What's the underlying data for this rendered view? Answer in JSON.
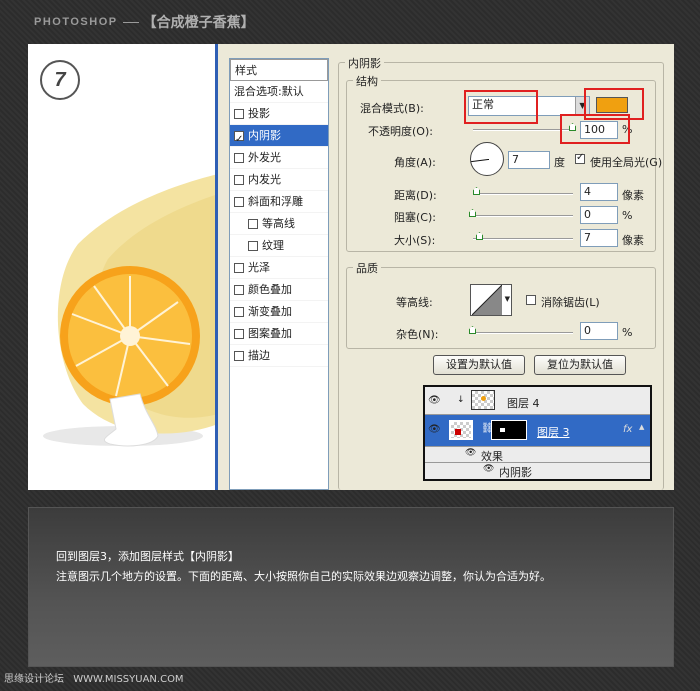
{
  "header": {
    "brand": "PHOTOSHOP",
    "title": "【合成橙子香蕉】"
  },
  "step_number": "7",
  "styles_panel": {
    "header": "样式",
    "items": [
      {
        "label": "混合选项:默认",
        "checkbox": false,
        "checked": false,
        "active": false,
        "indent": false
      },
      {
        "label": "投影",
        "checkbox": true,
        "checked": false,
        "active": false,
        "indent": false
      },
      {
        "label": "内阴影",
        "checkbox": true,
        "checked": true,
        "active": true,
        "indent": false
      },
      {
        "label": "外发光",
        "checkbox": true,
        "checked": false,
        "active": false,
        "indent": false
      },
      {
        "label": "内发光",
        "checkbox": true,
        "checked": false,
        "active": false,
        "indent": false
      },
      {
        "label": "斜面和浮雕",
        "checkbox": true,
        "checked": false,
        "active": false,
        "indent": false
      },
      {
        "label": "等高线",
        "checkbox": true,
        "checked": false,
        "active": false,
        "indent": true
      },
      {
        "label": "纹理",
        "checkbox": true,
        "checked": false,
        "active": false,
        "indent": true
      },
      {
        "label": "光泽",
        "checkbox": true,
        "checked": false,
        "active": false,
        "indent": false
      },
      {
        "label": "颜色叠加",
        "checkbox": true,
        "checked": false,
        "active": false,
        "indent": false
      },
      {
        "label": "渐变叠加",
        "checkbox": true,
        "checked": false,
        "active": false,
        "indent": false
      },
      {
        "label": "图案叠加",
        "checkbox": true,
        "checked": false,
        "active": false,
        "indent": false
      },
      {
        "label": "描边",
        "checkbox": true,
        "checked": false,
        "active": false,
        "indent": false
      }
    ]
  },
  "inner_shadow": {
    "group_title": "内阴影",
    "structure": {
      "title": "结构",
      "blend_mode_label": "混合模式(B):",
      "blend_mode_value": "正常",
      "shadow_color": "#f0a010",
      "opacity_label": "不透明度(O):",
      "opacity_value": "100",
      "opacity_percent": 100,
      "angle_label": "角度(A):",
      "angle_value": "7",
      "angle_unit": "度",
      "global_light_label": "使用全局光(G)",
      "global_light_checked": true,
      "distance_label": "距离(D):",
      "distance_value": "4",
      "distance_percent": 4,
      "choke_label": "阻塞(C):",
      "choke_value": "0",
      "choke_percent": 0,
      "size_label": "大小(S):",
      "size_value": "7",
      "size_percent": 7,
      "unit_px": "像素",
      "unit_percent": "%"
    },
    "quality": {
      "title": "品质",
      "contour_label": "等高线:",
      "anti_alias_label": "消除锯齿(L)",
      "noise_label": "杂色(N):",
      "noise_value": "0",
      "noise_percent": 0
    },
    "buttons": {
      "make_default": "设置为默认值",
      "reset_default": "复位为默认值"
    }
  },
  "layers_panel": {
    "layer4_name": "图层 4",
    "layer3_name": "图层 3",
    "effects_label": "效果",
    "effect_item": "内阴影",
    "fx_label": "fx"
  },
  "caption": {
    "line1": "回到图层3，添加图层样式【内阴影】",
    "line2": "注意图示几个地方的设置。下面的距离、大小按照你自己的实际效果边观察边调整，你认为合适为好。"
  },
  "footer": {
    "site_cn": "思缘设计论坛",
    "site_url": "WWW.MISSYUAN.COM"
  }
}
